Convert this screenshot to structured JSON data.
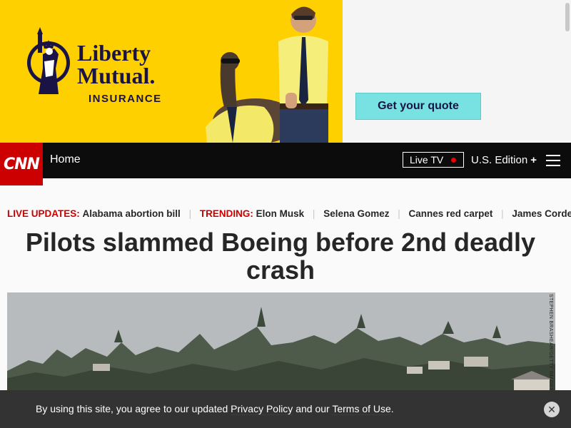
{
  "ad": {
    "brand_line1": "Liberty",
    "brand_line2": "Mutual.",
    "brand_line3": "INSURANCE",
    "cta_label": "Get your quote",
    "colors": {
      "background": "#ffd000",
      "cta": "#78e1e1",
      "brand": "#1a1446"
    }
  },
  "nav": {
    "logo": "CNN",
    "home_label": "Home",
    "live_tv_label": "Live TV",
    "edition_label": "U.S. Edition",
    "edition_icon": "plus-icon",
    "menu_icon": "hamburger-icon",
    "colors": {
      "bar": "#0c0c0c",
      "logo": "#cc0000"
    }
  },
  "trending": {
    "live_updates_label": "LIVE UPDATES:",
    "live_updates_item": "Alabama abortion bill",
    "trending_label": "TRENDING:",
    "items": [
      "Elon Musk",
      "Selena Gomez",
      "Cannes red carpet",
      "James Corden"
    ]
  },
  "article": {
    "headline": "Pilots slammed Boeing before 2nd deadly crash",
    "photo_credit": "STEPHEN BRASHEAR/GETTY IMAGES"
  },
  "cookie": {
    "text_before": "By using this site, you agree to our updated ",
    "privacy_link": "Privacy Policy",
    "text_middle": " and our ",
    "terms_link": "Terms of Use",
    "text_after": ".",
    "close_icon": "close-icon"
  }
}
